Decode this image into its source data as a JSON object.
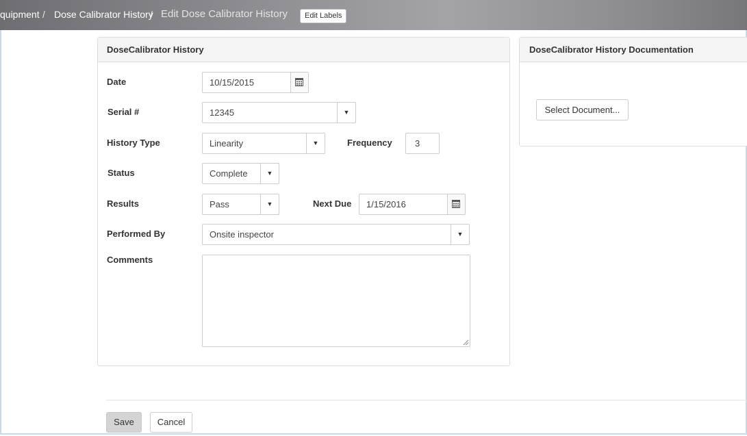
{
  "breadcrumb": {
    "items": [
      "quipment",
      "Dose Calibrator History",
      "Edit Dose Calibrator History"
    ],
    "separator": "/",
    "edit_labels": "Edit Labels"
  },
  "form_panel": {
    "title": "DoseCalibrator History",
    "date": {
      "label": "Date",
      "value": "10/15/2015",
      "icon": "calendar-icon"
    },
    "serial": {
      "label": "Serial #",
      "value": "12345"
    },
    "history_type": {
      "label": "History Type",
      "value": "Linearity"
    },
    "frequency": {
      "label": "Frequency",
      "value": "3"
    },
    "status": {
      "label": "Status",
      "value": "Complete"
    },
    "results": {
      "label": "Results",
      "value": "Pass"
    },
    "next_due": {
      "label": "Next Due",
      "value": "1/15/2016",
      "icon": "calendar-icon"
    },
    "performed_by": {
      "label": "Performed By",
      "value": "Onsite inspector"
    },
    "comments": {
      "label": "Comments",
      "value": ""
    },
    "caret_glyph": "▼"
  },
  "doc_panel": {
    "title": "DoseCalibrator History Documentation",
    "select_button": "Select Document..."
  },
  "actions": {
    "save": "Save",
    "cancel": "Cancel"
  },
  "colors": {
    "topbar": "#8e8e93",
    "panel_header": "#f5f5f5",
    "save_button": "#d4d4d4",
    "frame_border": "#c9d9ec"
  }
}
